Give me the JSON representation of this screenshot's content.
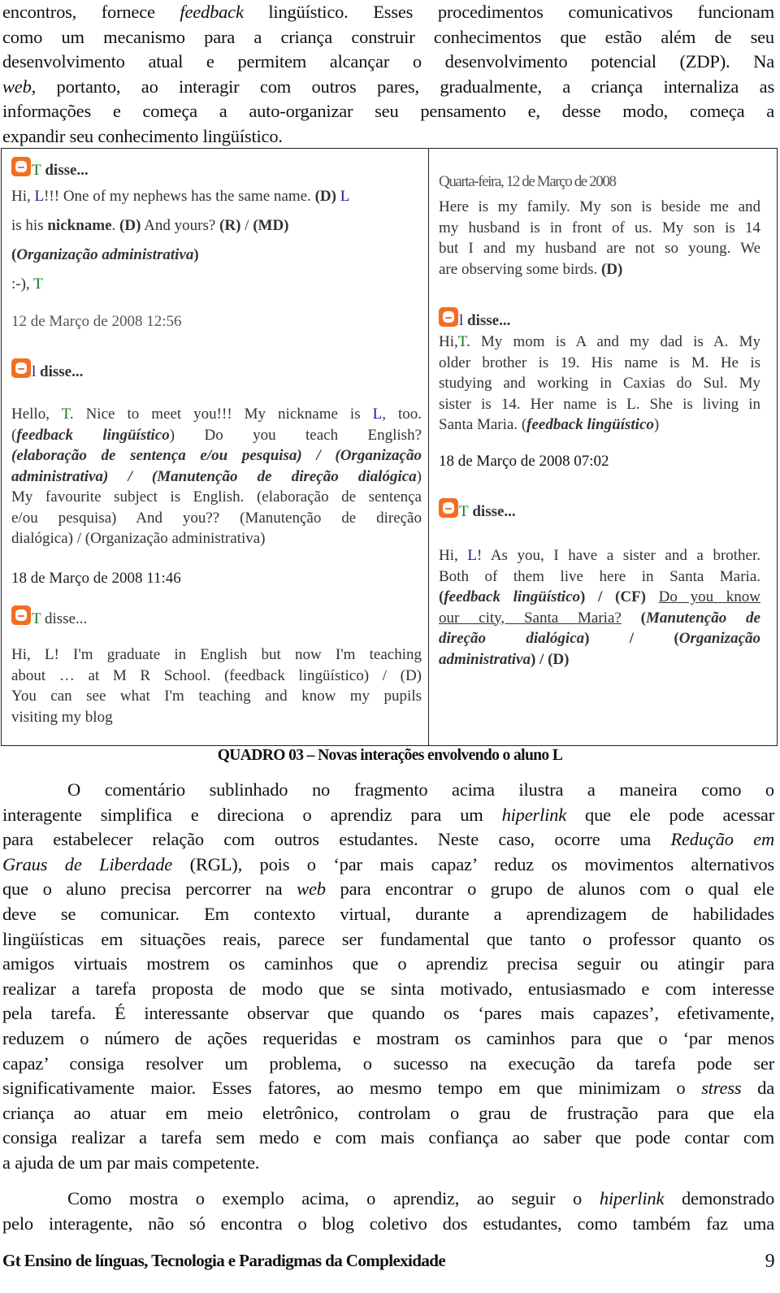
{
  "intro_paragraph": {
    "lines": [
      [
        "encontros, fornece ",
        {
          "i": "feedback"
        },
        " lingüístico. Esses procedimentos comunicativos funcionam"
      ],
      [
        "como um mecanismo para a criança construir conhecimentos que estão além de seu"
      ],
      [
        "desenvolvimento atual e permitem alcançar o desenvolvimento potencial (ZDP). Na"
      ],
      [
        {
          "i": "web"
        },
        ", portanto, ao interagir com outros pares, gradualmente, a criança internaliza as"
      ],
      [
        "informações e começa a auto-organizar seu pensamento e, desse modo, começa a"
      ],
      [
        "expandir seu conhecimento lingüístico."
      ]
    ]
  },
  "quadro": {
    "left_column": {
      "comment1": {
        "author": "T",
        "said": " disse...",
        "line1": [
          "Hi, ",
          "L",
          "!!! One of my nephews has the same name. ",
          "(D)",
          " ",
          "L"
        ],
        "line2": [
          "is his ",
          "nickname",
          ". ",
          "(D)",
          "  And yours? ",
          "(R)",
          " / ",
          "(MD)"
        ],
        "line3": [
          "(",
          "Organização administrativa",
          ")"
        ],
        "line4": [
          ":-), ",
          "T"
        ]
      },
      "timestamp1": "12 de Março de 2008 12:56",
      "comment2": {
        "author": "l",
        "said": " disse...",
        "lines": [
          "Hello, |T|. Nice to meet you!!! My nickname is |L|, too.",
          "(feedback lingüístico) Do you teach English?",
          "(elaboração de sentença e/ou pesquisa) / (Organização",
          "administrativa) / (Manutenção de direção dialógica)",
          "My favourite subject is English. (elaboração de sentença",
          "e/ou pesquisa) And you?? (Manutenção de direção",
          "dialógica) / (Organização administrativa)"
        ],
        "hello": "Hello, ",
        "t": "T",
        "mid": ". Nice to meet you!!! My nickname is ",
        "l": "L",
        "end": ", too.",
        "fb": "feedback lingüístico",
        "teach": " Do you teach English?",
        "elab": "elaboração de sentença e/ou pesquisa) / (Organização",
        "admin": "administrativa) / (",
        "manut": "Manutenção de direção dialógica",
        "fav": "My favourite subject is English. (elaboração de sentença",
        "eou": "e/ou pesquisa) And you?? (Manutenção de direção",
        "dial": "dialógica) / (Organização administrativa)"
      },
      "timestamp2": "18 de Março de 2008 11:46",
      "comment3": {
        "author": "T",
        "said": " disse...",
        "lines": [
          "Hi, L! I'm graduate in English but now I'm teaching",
          "about …  at M R School. (feedback lingüístico) / (D)",
          "You can see what I'm teaching and know my pupils",
          "visiting my blog"
        ]
      }
    },
    "right_column": {
      "post_date": "Quarta-feira, 12 de Março de 2008",
      "post_lines": [
        "Here is my family. My son is beside me and",
        "my husband is in front of us. My son is 14",
        "but I and my husband are not so young. We",
        "are observing some birds. "
      ],
      "post_tag": "(D)",
      "comment1": {
        "author": "l",
        "said": " disse...",
        "hi": "Hi,",
        "t": "T",
        "line1_rest": ". My mom is A and my dad is A. My",
        "lines": [
          "older brother is 19. His name is M. He is",
          "studying and working in Caxias do Sul. My",
          "sister is 14. Her name is L. She is living in"
        ],
        "last_prefix": "Santa Maria. (",
        "last_fb": "feedback lingüístico",
        "last_suffix": ")"
      },
      "timestamp": "18 de Março de 2008 07:02",
      "comment2": {
        "author": "T",
        "said": " disse...",
        "hi": "Hi, ",
        "l": "L",
        "line1_rest": "! As you, I have a sister and a brother.",
        "line2": "Both of them live here in Santa Maria.",
        "fb": "feedback lingüístico",
        "cf": ") / (CF) ",
        "underlined_a": "Do you know",
        "underlined_b": "our city, Santa Maria?",
        "manut": "Manutenção de",
        "direcao": "direção dialógica",
        "org": "Organização",
        "admin": "administrativa",
        "d_tail": ") / (D)"
      }
    }
  },
  "caption": "QUADRO 03 – Novas interações envolvendo o aluno L",
  "body": {
    "para1_lines": [
      [
        "O comentário sublinhado no fragmento acima ilustra a maneira como o"
      ],
      [
        "interagente simplifica e direciona o aprendiz para um ",
        {
          "i": "hiperlink"
        },
        " que ele pode acessar"
      ],
      [
        "para estabelecer relação com outros estudantes. Neste caso, ocorre uma ",
        {
          "i": "Redução em"
        }
      ],
      [
        {
          "i": "Graus de Liberdade"
        },
        " (RGL), pois o ‘par mais capaz’ reduz os movimentos alternativos"
      ],
      [
        "que o aluno precisa percorrer na ",
        {
          "i": "web"
        },
        " para encontrar o grupo de alunos com o qual ele"
      ],
      [
        "deve se comunicar. Em contexto virtual, durante a aprendizagem de habilidades"
      ],
      [
        "lingüísticas em situações reais, parece ser fundamental que tanto o professor quanto os"
      ],
      [
        "amigos virtuais mostrem os caminhos que o aprendiz precisa seguir ou atingir para"
      ],
      [
        "realizar a tarefa proposta de modo que se sinta motivado, entusiasmado e com interesse"
      ],
      [
        "pela tarefa. É interessante observar que quando os ‘pares mais capazes’, efetivamente,"
      ],
      [
        "reduzem o número de ações requeridas e mostram os caminhos para que o ‘par menos"
      ],
      [
        "capaz’ consiga resolver um problema, o sucesso na execução da tarefa pode ser"
      ],
      [
        "significativamente maior. Esses fatores, ao mesmo tempo em que minimizam o ",
        {
          "i": "stress"
        },
        " da"
      ],
      [
        "criança ao atuar em meio eletrônico, controlam o grau de frustração para que ela"
      ],
      [
        "consiga realizar a tarefa sem medo e com mais confiança ao saber que pode contar com"
      ],
      [
        "a ajuda de um par mais competente."
      ]
    ],
    "para2_lines": [
      [
        "Como mostra o exemplo acima, o aprendiz, ao seguir o ",
        {
          "i": "hiperlink"
        },
        " demonstrado"
      ],
      [
        "pelo interagente, não só encontra o blog coletivo dos estudantes, como também faz uma"
      ]
    ]
  },
  "footer": {
    "title": "Gt Ensino de línguas, Tecnologia e Paradigmas da Complexidade",
    "page_number": "9"
  },
  "colors": {
    "blogger_orange": "#f26f21",
    "name_green": "#1a7a1a",
    "name_blue": "#1a1aa0"
  }
}
